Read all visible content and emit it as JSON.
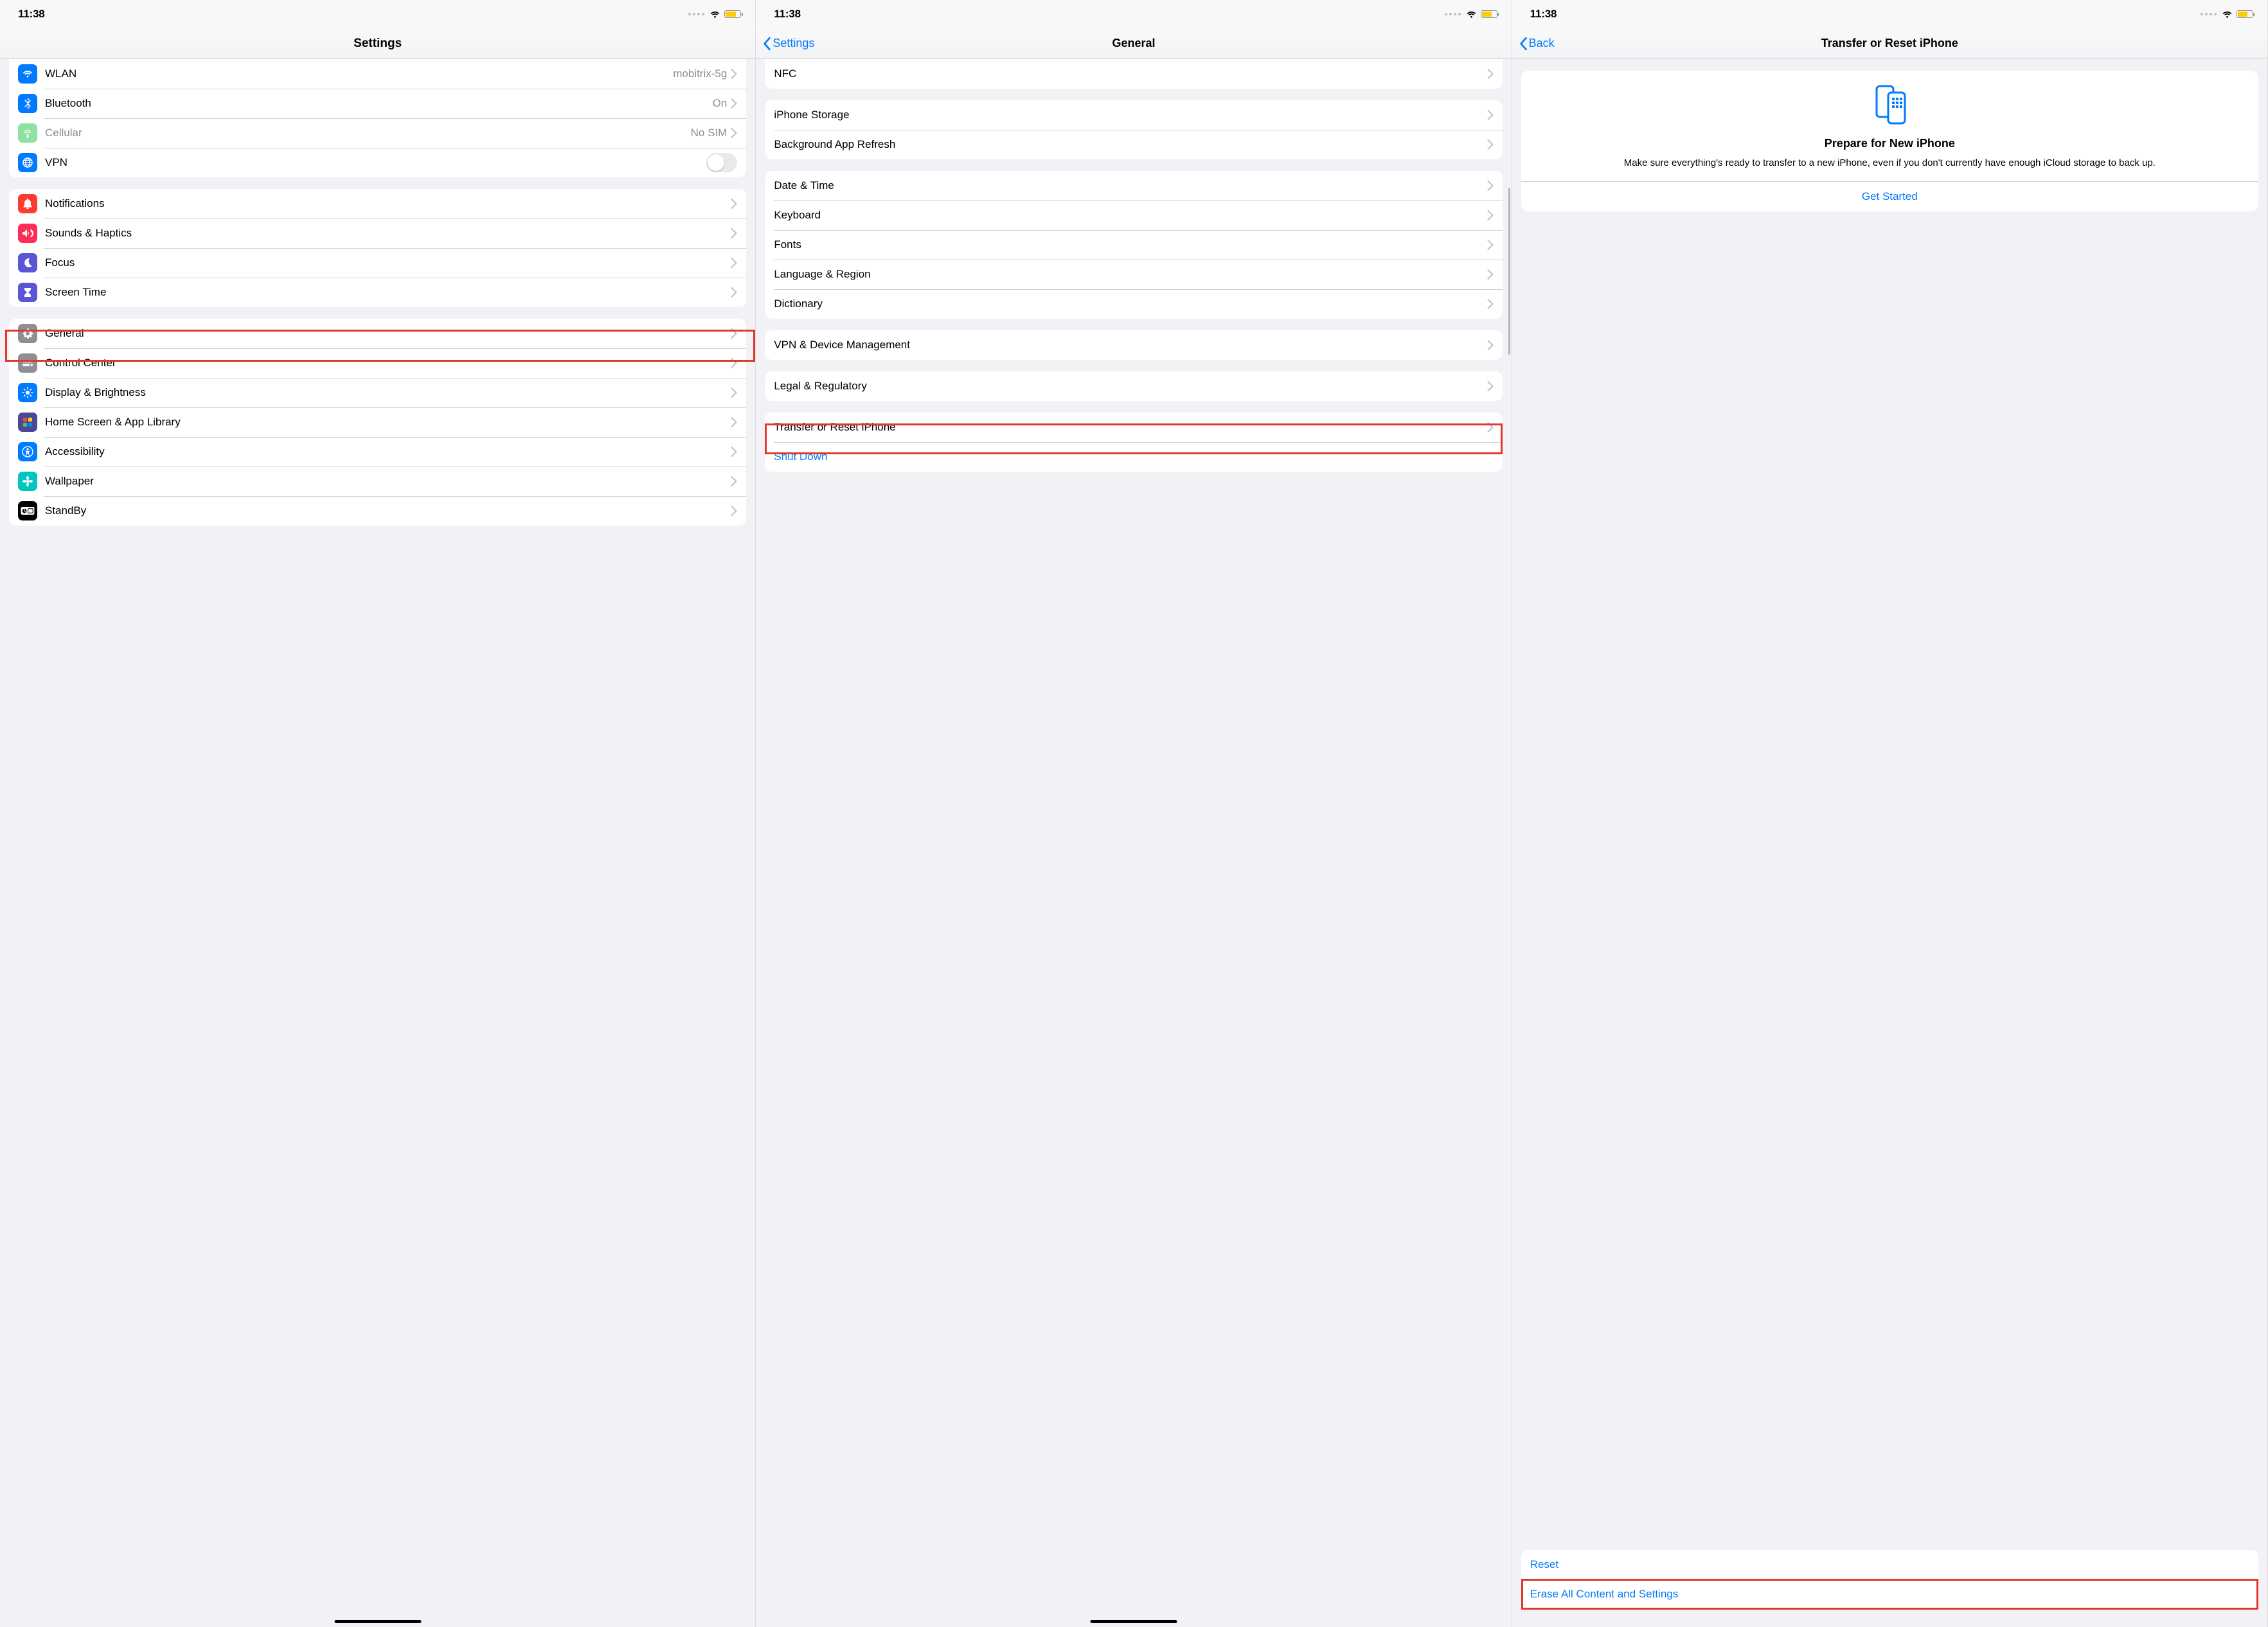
{
  "status": {
    "time": "11:38"
  },
  "screen1": {
    "title": "Settings",
    "groupConn": [
      {
        "label": "WLAN",
        "value": "mobitrix-5g",
        "icon": "wifi",
        "color": "#007aff"
      },
      {
        "label": "Bluetooth",
        "value": "On",
        "icon": "bluetooth",
        "color": "#007aff"
      },
      {
        "label": "Cellular",
        "value": "No SIM",
        "icon": "cellular",
        "color": "#34c759",
        "disabled": true
      },
      {
        "label": "VPN",
        "value": "",
        "icon": "vpn",
        "color": "#007aff",
        "toggle": true
      }
    ],
    "groupNotif": [
      {
        "label": "Notifications",
        "icon": "bell",
        "color": "#ff3b30"
      },
      {
        "label": "Sounds & Haptics",
        "icon": "sound",
        "color": "#ff2d55"
      },
      {
        "label": "Focus",
        "icon": "moon",
        "color": "#5856d6"
      },
      {
        "label": "Screen Time",
        "icon": "timer",
        "color": "#5856d6"
      }
    ],
    "groupSys": [
      {
        "label": "General",
        "icon": "gear",
        "color": "#8e8e93",
        "highlight": true
      },
      {
        "label": "Control Center",
        "icon": "switches",
        "color": "#8e8e93"
      },
      {
        "label": "Display & Brightness",
        "icon": "brightness",
        "color": "#007aff"
      },
      {
        "label": "Home Screen & App Library",
        "icon": "grid",
        "color": "#5856d6"
      },
      {
        "label": "Accessibility",
        "icon": "person",
        "color": "#007aff"
      },
      {
        "label": "Wallpaper",
        "icon": "flower",
        "color": "#00c7be"
      },
      {
        "label": "StandBy",
        "icon": "clock",
        "color": "#000000"
      }
    ]
  },
  "screen2": {
    "back": "Settings",
    "title": "General",
    "groupTop": [
      {
        "label": "NFC"
      }
    ],
    "groupStore": [
      {
        "label": "iPhone Storage"
      },
      {
        "label": "Background App Refresh"
      }
    ],
    "groupLang": [
      {
        "label": "Date & Time"
      },
      {
        "label": "Keyboard"
      },
      {
        "label": "Fonts"
      },
      {
        "label": "Language & Region"
      },
      {
        "label": "Dictionary"
      }
    ],
    "groupVPN": [
      {
        "label": "VPN & Device Management"
      }
    ],
    "groupLegal": [
      {
        "label": "Legal & Regulatory"
      }
    ],
    "groupReset": [
      {
        "label": "Transfer or Reset iPhone",
        "highlight": true
      },
      {
        "label": "Shut Down",
        "blue": true,
        "noChevron": true
      }
    ]
  },
  "screen3": {
    "back": "Back",
    "title": "Transfer or Reset iPhone",
    "card": {
      "heading": "Prepare for New iPhone",
      "body": "Make sure everything's ready to transfer to a new iPhone, even if you don't currently have enough iCloud storage to back up.",
      "action": "Get Started"
    },
    "actions": [
      {
        "label": "Reset"
      },
      {
        "label": "Erase All Content and Settings",
        "highlight": true
      }
    ]
  }
}
